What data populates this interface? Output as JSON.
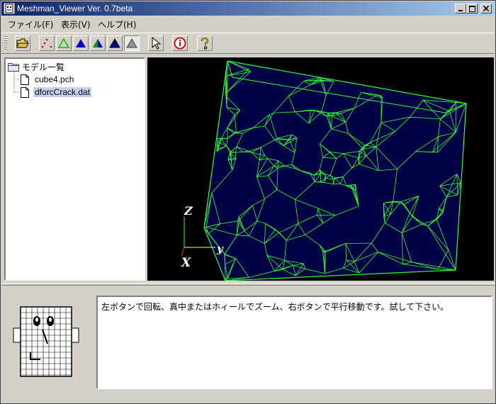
{
  "window": {
    "title": "Meshman_Viewer Ver. 0.7beta",
    "controls": [
      "minimize",
      "maximize",
      "close"
    ]
  },
  "menu": [
    {
      "label": "ファイル(F)"
    },
    {
      "label": "表示(V)"
    },
    {
      "label": "ヘルプ(H)"
    }
  ],
  "toolbar": {
    "buttons": [
      {
        "name": "open-folder-icon"
      },
      {
        "name": "show-nodes-icon"
      },
      {
        "name": "wireframe-icon"
      },
      {
        "name": "solid-blue-icon"
      },
      {
        "name": "solid-shaded-icon"
      },
      {
        "name": "solid-blue-mesh-icon"
      },
      {
        "name": "solid-gray-icon"
      },
      {
        "name": "pointer-icon"
      },
      {
        "name": "info-icon"
      },
      {
        "name": "help-icon"
      }
    ]
  },
  "tree": {
    "root": "モデル一覧",
    "items": [
      "cube4.pch",
      "dforcCrack.dat"
    ],
    "selected_index": 1
  },
  "viewport": {
    "background": "#000000",
    "mesh_color": "#33ff33",
    "model_fill": "#000044",
    "axes": {
      "z": "Z",
      "y": "y",
      "x": "X"
    }
  },
  "message": {
    "text": "左ボタンで回転、真中またはホィールでズーム、右ボタンで平行移動です。試して下さい。"
  },
  "colors": {
    "titlebar_start": "#0a246a",
    "titlebar_end": "#a6caf0",
    "face": "#d4d0c8",
    "selection": "#c8d0f0"
  }
}
